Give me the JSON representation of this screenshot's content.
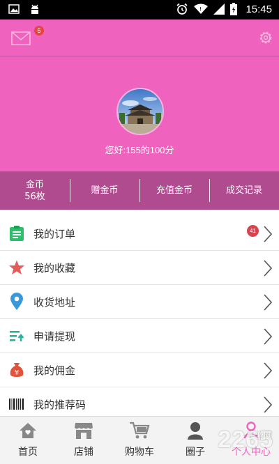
{
  "status_bar": {
    "time": "15:45",
    "icons": [
      "image-icon",
      "android-icon",
      "alarm-icon",
      "wifi-icon",
      "signal-icon",
      "battery-icon"
    ]
  },
  "header": {
    "mail_badge": "5",
    "greeting": "您好:155的100分",
    "background_color": "#ef63bf"
  },
  "stats": {
    "coins_label": "金币",
    "coins_value": "56枚",
    "gift_coins": "赠金币",
    "recharge": "充值金币",
    "records": "成交记录"
  },
  "menu": {
    "items": [
      {
        "label": "我的订单",
        "icon": "order-icon",
        "badge": "41"
      },
      {
        "label": "我的收藏",
        "icon": "star-icon"
      },
      {
        "label": "收货地址",
        "icon": "location-pin-icon"
      },
      {
        "label": "申请提现",
        "icon": "withdraw-icon"
      },
      {
        "label": "我的佣金",
        "icon": "money-bag-icon"
      },
      {
        "label": "我的推荐码",
        "icon": "barcode-icon"
      }
    ]
  },
  "tabs": [
    {
      "label": "首页",
      "icon": "home-icon"
    },
    {
      "label": "店铺",
      "icon": "store-icon"
    },
    {
      "label": "购物车",
      "icon": "cart-icon"
    },
    {
      "label": "圈子",
      "icon": "circle-icon"
    },
    {
      "label": "个人中心",
      "icon": "profile-icon",
      "active": true
    }
  ],
  "watermark": {
    "text": "2265",
    "sub": "手游网"
  },
  "colors": {
    "accent": "#ef63bf",
    "stats_bar": "#b04b8f",
    "badge": "#d9434e"
  }
}
